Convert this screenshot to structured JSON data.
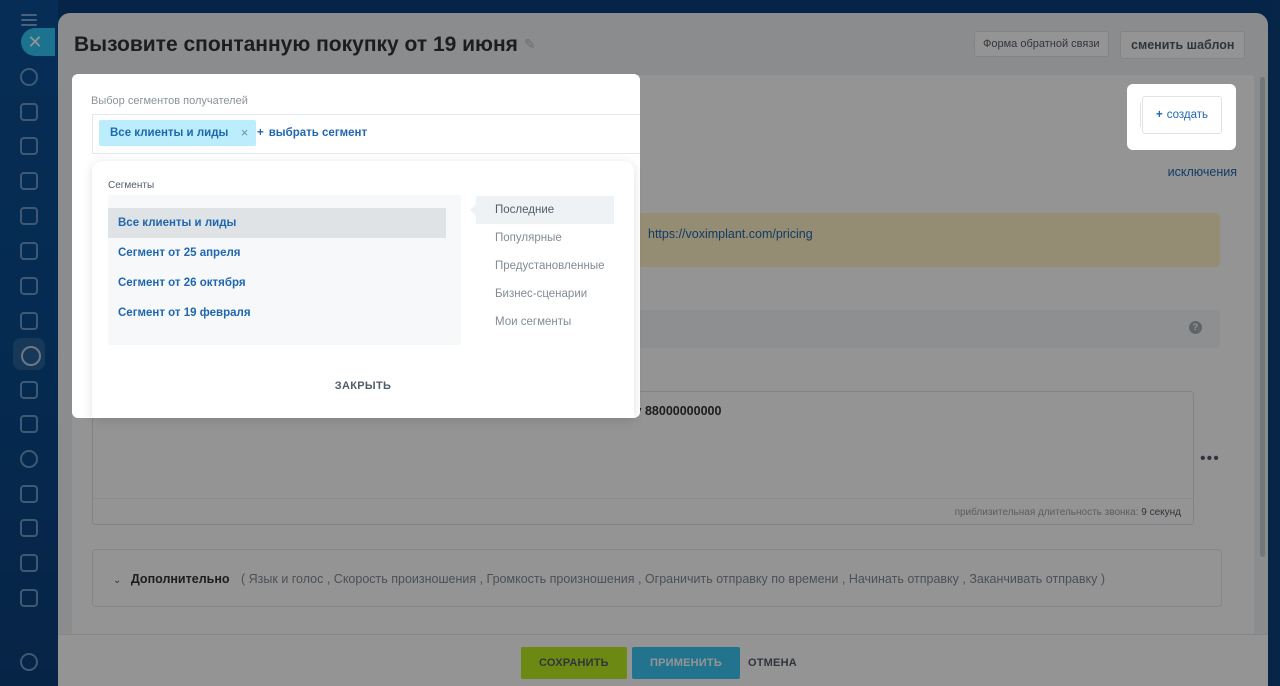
{
  "page": {
    "title": "Вызовите спонтанную покупку от 19 июня",
    "feedback_button": "Форма обратной связи",
    "change_template_button": "сменить шаблон"
  },
  "form": {
    "exclusions_link": "исключения",
    "warning_link": "https://voximplant.com/pricing",
    "message_text": "ну 88000000000",
    "call_duration_label": "приблизительная длительность звонка:",
    "call_duration_value": "9 секунд",
    "additional": {
      "label": "Дополнительно",
      "options": "( Язык и голос ,  Скорость произношения ,  Громкость произношения ,  Ограничить отправку по времени ,  Начинать отправку ,  Заканчивать отправку  )"
    }
  },
  "create": {
    "label": "создать"
  },
  "segments": {
    "label": "Выбор сегментов получателей",
    "selected_tag": "Все клиенты и лиды",
    "add_label": "выбрать сегмент",
    "popup": {
      "title": "Сегменты",
      "items": [
        "Все клиенты и лиды",
        "Сегмент от 25 апреля",
        "Сегмент от 26 октября",
        "Сегмент от 19 февраля"
      ],
      "tabs": [
        "Последние",
        "Популярные",
        "Предустановленные",
        "Бизнес-сценарии",
        "Мои сегменты"
      ],
      "close_label": "ЗАКРЫТЬ"
    }
  },
  "footer": {
    "save": "СОХРАНИТЬ",
    "apply": "ПРИМЕНИТЬ",
    "cancel": "ОТМЕНА"
  },
  "colors": {
    "accent_link": "#2067b0",
    "save_button": "#bbed21",
    "apply_button": "#3bc8f5",
    "tag_background": "#bcedfc",
    "warning_background": "#fff1c6"
  }
}
